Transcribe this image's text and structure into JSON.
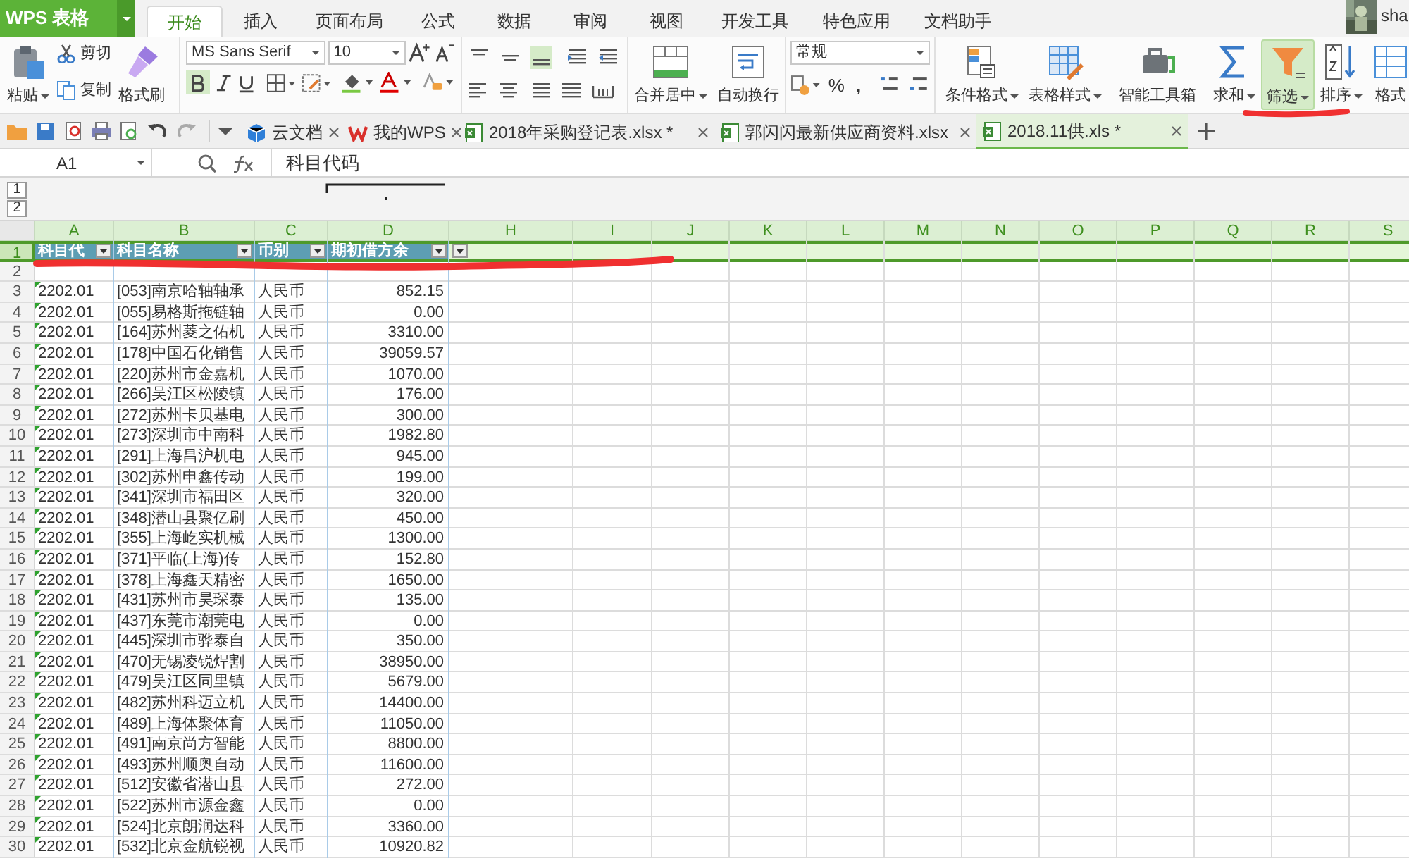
{
  "app_button": {
    "label": "WPS 表格"
  },
  "menu_tabs": [
    {
      "label": "开始",
      "selected": true
    },
    {
      "label": "插入",
      "selected": false
    },
    {
      "label": "页面布局",
      "selected": false
    },
    {
      "label": "公式",
      "selected": false
    },
    {
      "label": "数据",
      "selected": false
    },
    {
      "label": "审阅",
      "selected": false
    },
    {
      "label": "视图",
      "selected": false
    },
    {
      "label": "开发工具",
      "selected": false
    },
    {
      "label": "特色应用",
      "selected": false
    },
    {
      "label": "文档助手",
      "selected": false
    }
  ],
  "user": {
    "name": "sha"
  },
  "clipboard": {
    "paste": "粘贴",
    "cut": "剪切",
    "copy": "复制",
    "format_painter": "格式刷"
  },
  "font": {
    "name": "MS Sans Serif",
    "size": "10",
    "bold": true
  },
  "merge_label": "合并居中",
  "wrap_label": "自动换行",
  "number_format": {
    "value": "常规",
    "percent": "%",
    "comma": ","
  },
  "tools": [
    {
      "label": "条件格式",
      "dropdown": true,
      "active": false
    },
    {
      "label": "表格样式",
      "dropdown": true,
      "active": false
    },
    {
      "label": "智能工具箱",
      "dropdown": false,
      "active": false
    },
    {
      "label": "求和",
      "dropdown": true,
      "active": false
    },
    {
      "label": "筛选",
      "dropdown": true,
      "active": true
    },
    {
      "label": "排序",
      "dropdown": true,
      "active": false
    },
    {
      "label": "格式",
      "dropdown": false,
      "active": false
    }
  ],
  "doc_tabs": [
    {
      "label": "云文档",
      "kind": "cloud",
      "selected": false
    },
    {
      "label": "我的WPS",
      "kind": "wps",
      "selected": false
    },
    {
      "label": "2018年采购登记表.xlsx *",
      "kind": "sheet",
      "selected": false
    },
    {
      "label": "郭闪闪最新供应商资料.xlsx",
      "kind": "sheet",
      "selected": false
    },
    {
      "label": "2018.11供.xls *",
      "kind": "sheet",
      "selected": true
    }
  ],
  "formula_bar": {
    "cell": "A1",
    "content": "科目代码"
  },
  "outline_levels": [
    "1",
    "2"
  ],
  "columns": [
    {
      "label": "A"
    },
    {
      "label": "B"
    },
    {
      "label": "C"
    },
    {
      "label": "D"
    },
    {
      "label": "H"
    },
    {
      "label": "I"
    },
    {
      "label": "J"
    },
    {
      "label": "K"
    },
    {
      "label": "L"
    },
    {
      "label": "M"
    },
    {
      "label": "N"
    },
    {
      "label": "O"
    },
    {
      "label": "P"
    },
    {
      "label": "Q"
    },
    {
      "label": "R"
    },
    {
      "label": "S"
    }
  ],
  "header_row": {
    "number": "1",
    "selected": true,
    "cells": [
      "科目代",
      "科目名称",
      "币别",
      "期初借方余"
    ]
  },
  "rows": [
    {
      "number": "2",
      "cells": []
    },
    {
      "number": "3",
      "cells": [
        "2202.01",
        "[053]南京哈轴轴承",
        "人民币",
        "852.15"
      ]
    },
    {
      "number": "4",
      "cells": [
        "2202.01",
        "[055]易格斯拖链轴",
        "人民币",
        "0.00"
      ]
    },
    {
      "number": "5",
      "cells": [
        "2202.01",
        "[164]苏州菱之佑机",
        "人民币",
        "3310.00"
      ]
    },
    {
      "number": "6",
      "cells": [
        "2202.01",
        "[178]中国石化销售",
        "人民币",
        "39059.57"
      ]
    },
    {
      "number": "7",
      "cells": [
        "2202.01",
        "[220]苏州市金嘉机",
        "人民币",
        "1070.00"
      ]
    },
    {
      "number": "8",
      "cells": [
        "2202.01",
        "[266]吴江区松陵镇",
        "人民币",
        "176.00"
      ]
    },
    {
      "number": "9",
      "cells": [
        "2202.01",
        "[272]苏州卡贝基电",
        "人民币",
        "300.00"
      ]
    },
    {
      "number": "10",
      "cells": [
        "2202.01",
        "[273]深圳市中南科",
        "人民币",
        "1982.80"
      ]
    },
    {
      "number": "11",
      "cells": [
        "2202.01",
        "[291]上海昌沪机电",
        "人民币",
        "945.00"
      ]
    },
    {
      "number": "12",
      "cells": [
        "2202.01",
        "[302]苏州申鑫传动",
        "人民币",
        "199.00"
      ]
    },
    {
      "number": "13",
      "cells": [
        "2202.01",
        "[341]深圳市福田区",
        "人民币",
        "320.00"
      ]
    },
    {
      "number": "14",
      "cells": [
        "2202.01",
        "[348]潜山县聚亿刷",
        "人民币",
        "450.00"
      ]
    },
    {
      "number": "15",
      "cells": [
        "2202.01",
        "[355]上海屹实机械",
        "人民币",
        "1300.00"
      ]
    },
    {
      "number": "16",
      "cells": [
        "2202.01",
        "[371]平临(上海)传",
        "人民币",
        "152.80"
      ]
    },
    {
      "number": "17",
      "cells": [
        "2202.01",
        "[378]上海鑫天精密",
        "人民币",
        "1650.00"
      ]
    },
    {
      "number": "18",
      "cells": [
        "2202.01",
        "[431]苏州市昊琛泰",
        "人民币",
        "135.00"
      ]
    },
    {
      "number": "19",
      "cells": [
        "2202.01",
        "[437]东莞市潮莞电",
        "人民币",
        "0.00"
      ]
    },
    {
      "number": "20",
      "cells": [
        "2202.01",
        "[445]深圳市骅泰自",
        "人民币",
        "350.00"
      ]
    },
    {
      "number": "21",
      "cells": [
        "2202.01",
        "[470]无锡凌锐焊割",
        "人民币",
        "38950.00"
      ]
    },
    {
      "number": "22",
      "cells": [
        "2202.01",
        "[479]吴江区同里镇",
        "人民币",
        "5679.00"
      ]
    },
    {
      "number": "23",
      "cells": [
        "2202.01",
        "[482]苏州科迈立机",
        "人民币",
        "14400.00"
      ]
    },
    {
      "number": "24",
      "cells": [
        "2202.01",
        "[489]上海体聚体育",
        "人民币",
        "11050.00"
      ]
    },
    {
      "number": "25",
      "cells": [
        "2202.01",
        "[491]南京尚方智能",
        "人民币",
        "8800.00"
      ]
    },
    {
      "number": "26",
      "cells": [
        "2202.01",
        "[493]苏州顺奥自动",
        "人民币",
        "11600.00"
      ]
    },
    {
      "number": "27",
      "cells": [
        "2202.01",
        "[512]安徽省潜山县",
        "人民币",
        "272.00"
      ]
    },
    {
      "number": "28",
      "cells": [
        "2202.01",
        "[522]苏州市源金鑫",
        "人民币",
        "0.00"
      ]
    },
    {
      "number": "29",
      "cells": [
        "2202.01",
        "[524]北京朗润达科",
        "人民币",
        "3360.00"
      ]
    },
    {
      "number": "30",
      "cells": [
        "2202.01",
        "[532]北京金航锐视",
        "人民币",
        "10920.82"
      ]
    }
  ]
}
